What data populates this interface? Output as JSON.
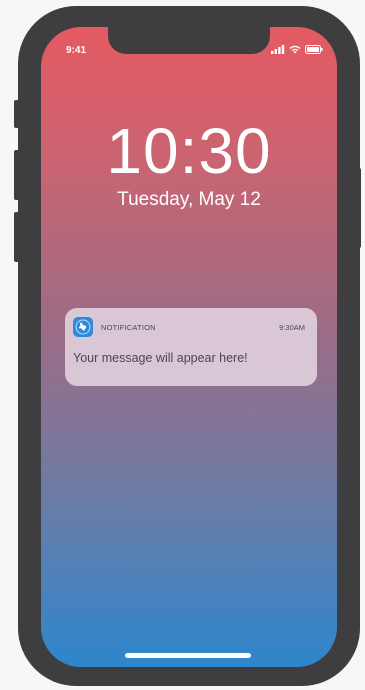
{
  "status_bar": {
    "time": "9:41",
    "icons": [
      "signal-icon",
      "wifi-icon",
      "battery-icon"
    ]
  },
  "lock_screen": {
    "time": "10:30",
    "date": "Tuesday, May 12"
  },
  "notification": {
    "app_label": "NOTIFICATION",
    "time": "9:30AM",
    "message": "Your message will appear here!",
    "icon": "texas-map-icon"
  },
  "colors": {
    "gradient_top": "#e55a62",
    "gradient_bottom": "#2e86cc",
    "frame": "#3e3e41",
    "app_icon": "#2f88d8"
  }
}
